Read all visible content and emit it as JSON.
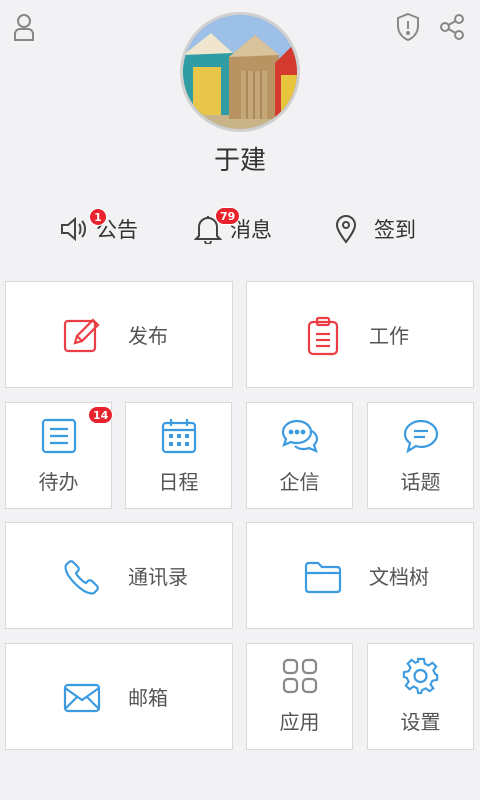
{
  "header": {
    "user_icon": "user-icon",
    "shield_icon": "shield-alert-icon",
    "share_icon": "share-icon"
  },
  "profile": {
    "name": "于建"
  },
  "quick_actions": [
    {
      "label": "公告",
      "icon": "speaker-icon",
      "badge": "1"
    },
    {
      "label": "消息",
      "icon": "bell-icon",
      "badge": "79"
    },
    {
      "label": "签到",
      "icon": "location-pin-icon",
      "badge": ""
    }
  ],
  "tiles": {
    "publish": {
      "label": "发布",
      "icon": "edit-icon"
    },
    "work": {
      "label": "工作",
      "icon": "clipboard-icon"
    },
    "todo": {
      "label": "待办",
      "icon": "list-icon",
      "badge": "14"
    },
    "schedule": {
      "label": "日程",
      "icon": "calendar-icon"
    },
    "message": {
      "label": "企信",
      "icon": "chat-bubbles-icon"
    },
    "topic": {
      "label": "话题",
      "icon": "comment-icon"
    },
    "contacts": {
      "label": "通讯录",
      "icon": "phone-icon"
    },
    "docs": {
      "label": "文档树",
      "icon": "folder-icon"
    },
    "mail": {
      "label": "邮箱",
      "icon": "mail-icon"
    },
    "apps": {
      "label": "应用",
      "icon": "grid-icon"
    },
    "settings": {
      "label": "设置",
      "icon": "gear-icon"
    }
  },
  "colors": {
    "background": "#f2f2f4",
    "accent_blue": "#3c9be0",
    "accent_red": "#ea3e44",
    "badge_red": "#e8232d",
    "tile_border": "#d9d9d9"
  }
}
